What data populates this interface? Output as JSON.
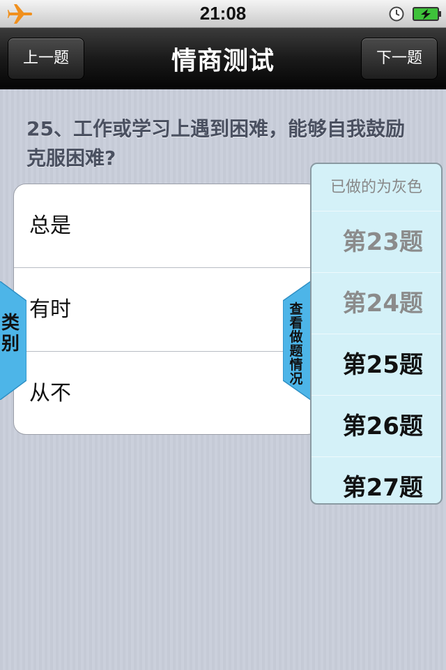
{
  "status_bar": {
    "time": "21:08",
    "icons": [
      "airplane-icon",
      "clock-icon",
      "battery-charging-icon"
    ],
    "colors": {
      "airplane": "#f0901e",
      "battery": "#3ec23a"
    }
  },
  "nav": {
    "title": "情商测试",
    "prev_label": "上一题",
    "next_label": "下一题"
  },
  "question": {
    "text": "25、工作或学习上遇到困难，能够自我鼓励克服困难?"
  },
  "answers": [
    {
      "label": "总是"
    },
    {
      "label": "有时"
    },
    {
      "label": "从不"
    }
  ],
  "left_tab": {
    "label": "类别",
    "color": "#4db5e8"
  },
  "right_tab": {
    "label": "查看做题情况",
    "color": "#4db5e8"
  },
  "panel": {
    "header": "已做的为灰色",
    "items": [
      {
        "label": "第23题",
        "done": true
      },
      {
        "label": "第24题",
        "done": true
      },
      {
        "label": "第25题",
        "done": false
      },
      {
        "label": "第26题",
        "done": false
      },
      {
        "label": "第27题",
        "done": false
      }
    ],
    "background": "#d4f1f8"
  }
}
